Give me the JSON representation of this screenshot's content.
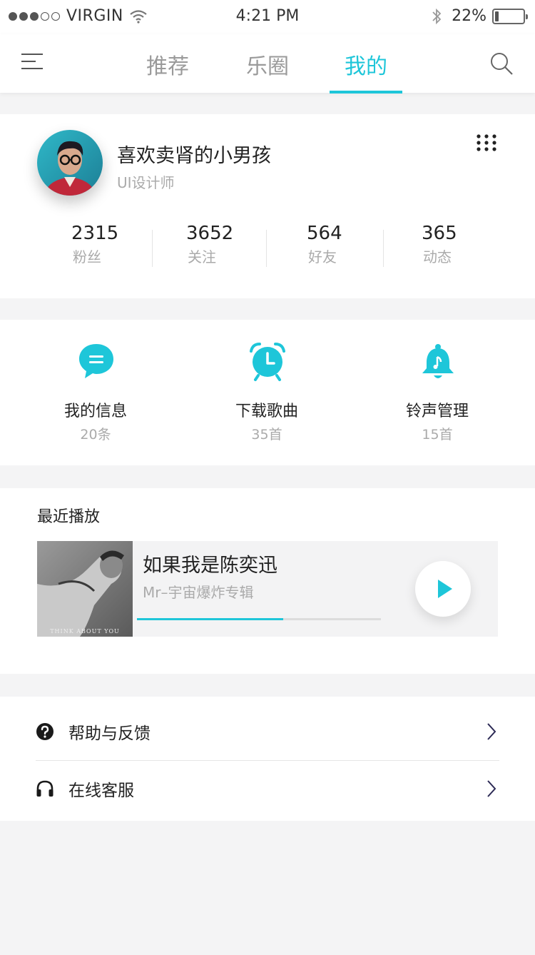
{
  "status_bar": {
    "carrier": "VIRGIN",
    "time": "4:21 PM",
    "battery_percent": "22%",
    "battery_level": 0.22,
    "signal_dots_filled": 3,
    "signal_dots_total": 5
  },
  "nav": {
    "tabs": [
      {
        "label": "推荐",
        "active": false
      },
      {
        "label": "乐圈",
        "active": false
      },
      {
        "label": "我的",
        "active": true
      }
    ],
    "accent": "#1ec6d9"
  },
  "profile": {
    "name": "喜欢卖肾的小男孩",
    "title": "UI设计师",
    "stats": [
      {
        "value": "2315",
        "label": "粉丝"
      },
      {
        "value": "3652",
        "label": "关注"
      },
      {
        "value": "564",
        "label": "好友"
      },
      {
        "value": "365",
        "label": "动态"
      }
    ]
  },
  "functions": [
    {
      "label": "我的信息",
      "count": "20条",
      "icon": "message-icon"
    },
    {
      "label": "下载歌曲",
      "count": "35首",
      "icon": "alarm-clock-icon"
    },
    {
      "label": "铃声管理",
      "count": "15首",
      "icon": "bell-icon"
    }
  ],
  "recent": {
    "title": "最近播放",
    "song": {
      "title": "如果我是陈奕迅",
      "album": "Mr–宇宙爆炸专辑",
      "cover_caption": "THINK ABOUT YOU",
      "progress": 0.6
    }
  },
  "menu": [
    {
      "label": "帮助与反馈",
      "icon": "help-icon"
    },
    {
      "label": "在线客服",
      "icon": "headphones-icon"
    }
  ]
}
